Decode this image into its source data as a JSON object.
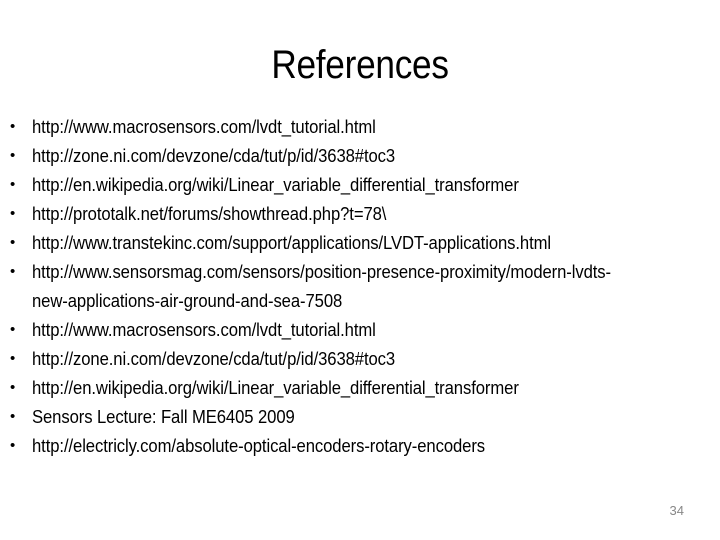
{
  "slide": {
    "title": "References",
    "page_number": "34",
    "bullet_marker": "•",
    "text_color": "#000000",
    "page_number_color": "#888888",
    "background_color": "#ffffff"
  },
  "references": [
    {
      "text": "http://www.macrosensors.com/lvdt_tutorial.html"
    },
    {
      "text": "http://zone.ni.com/devzone/cda/tut/p/id/3638#toc3"
    },
    {
      "text": "http://en.wikipedia.org/wiki/Linear_variable_differential_transformer"
    },
    {
      "text": "http://prototalk.net/forums/showthread.php?t=78\\"
    },
    {
      "text": "http://www.transtekinc.com/support/applications/LVDT-applications.html"
    },
    {
      "text": "http://www.sensorsmag.com/sensors/position-presence-proximity/modern-lvdts-new-applications-air-ground-and-sea-7508"
    },
    {
      "text": "http://www.macrosensors.com/lvdt_tutorial.html"
    },
    {
      "text": "http://zone.ni.com/devzone/cda/tut/p/id/3638#toc3"
    },
    {
      "text": "http://en.wikipedia.org/wiki/Linear_variable_differential_transformer"
    },
    {
      "text": "Sensors Lecture: Fall ME6405 2009"
    },
    {
      "text": "http://electricly.com/absolute-optical-encoders-rotary-encoders"
    }
  ]
}
